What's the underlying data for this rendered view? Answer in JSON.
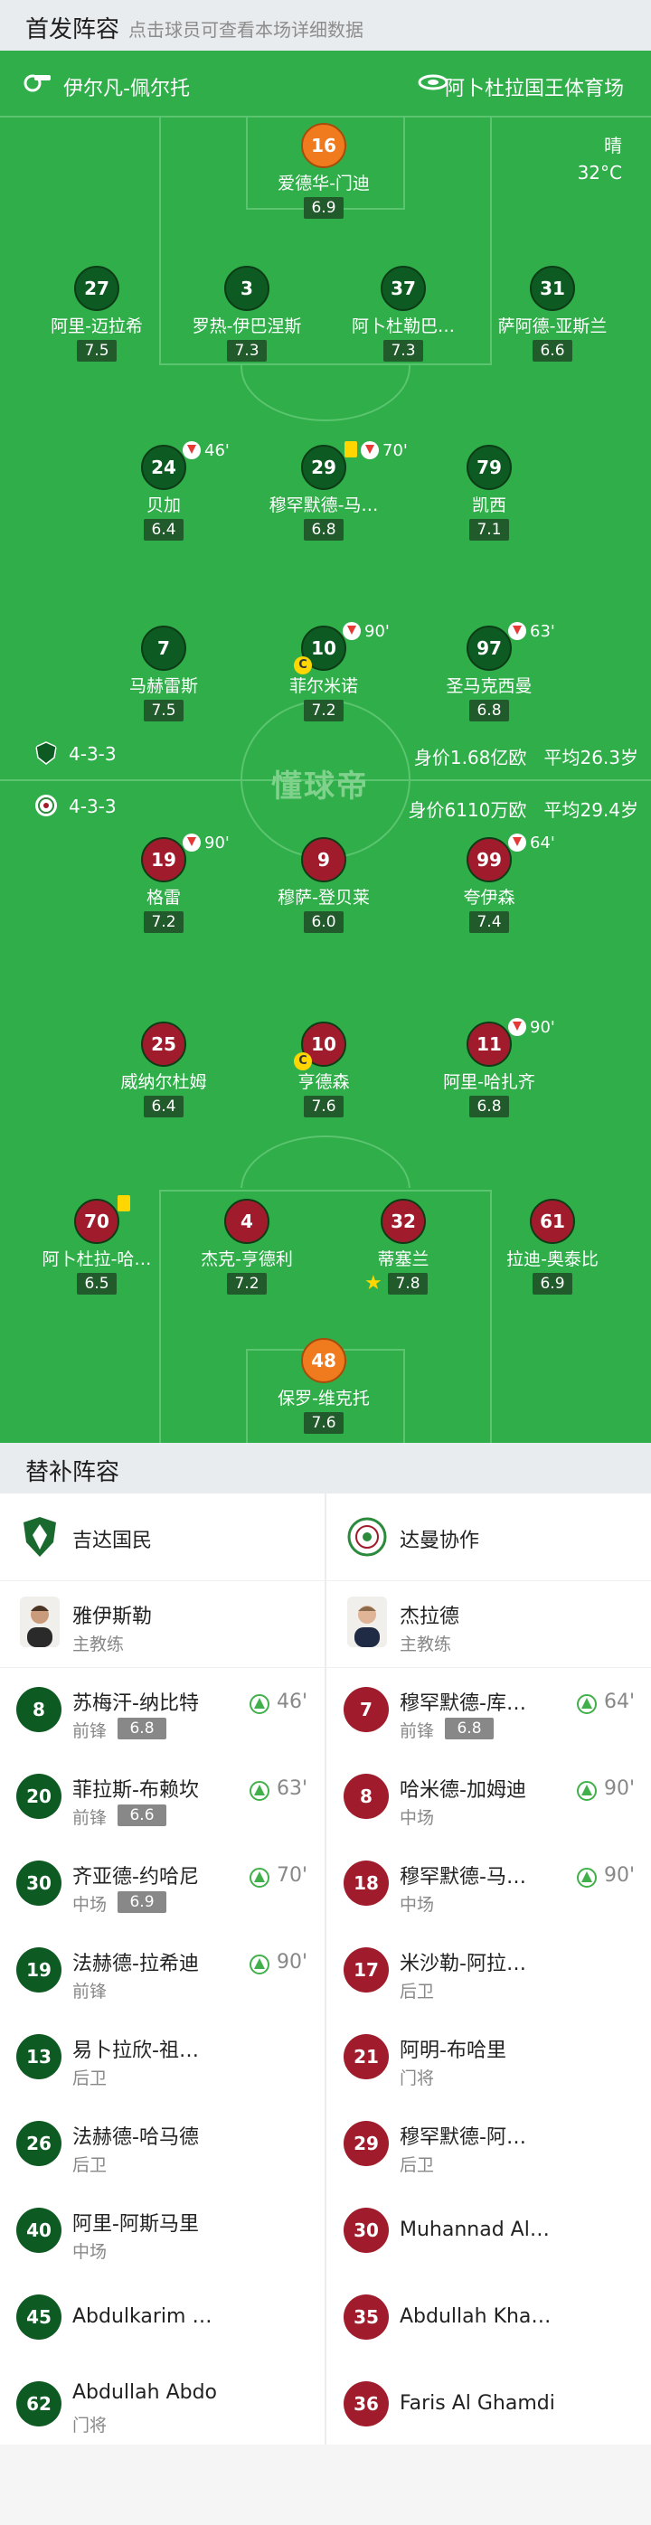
{
  "header": {
    "title": "首发阵容",
    "subtitle": "点击球员可查看本场详细数据"
  },
  "pitch": {
    "referee": "伊尔凡-佩尔托",
    "venue": "阿卜杜拉国王体育场",
    "weather": "晴",
    "temperature": "32°C",
    "watermark": "懂球帝"
  },
  "home_team": {
    "formation": "4-3-3",
    "value": "身价1.68亿欧",
    "avg_age": "平均26.3岁",
    "color": "#0d5a22"
  },
  "away_team": {
    "formation": "4-3-3",
    "value": "身价6110万欧",
    "avg_age": "平均29.4岁",
    "color": "#a01c2c"
  },
  "home_players": [
    {
      "num": "16",
      "name": "爱德华-门迪",
      "rating": "6.9"
    },
    {
      "num": "27",
      "name": "阿里-迈拉希",
      "rating": "7.5"
    },
    {
      "num": "3",
      "name": "罗热-伊巴涅斯",
      "rating": "7.3"
    },
    {
      "num": "37",
      "name": "阿卜杜勒巴…",
      "rating": "7.3"
    },
    {
      "num": "31",
      "name": "萨阿德-亚斯兰",
      "rating": "6.6"
    },
    {
      "num": "24",
      "name": "贝加",
      "rating": "6.4",
      "sub_min": "46'"
    },
    {
      "num": "29",
      "name": "穆罕默德-马…",
      "rating": "6.8",
      "sub_min": "70'"
    },
    {
      "num": "79",
      "name": "凯西",
      "rating": "7.1"
    },
    {
      "num": "7",
      "name": "马赫雷斯",
      "rating": "7.5"
    },
    {
      "num": "10",
      "name": "菲尔米诺",
      "rating": "7.2",
      "sub_min": "90'",
      "captain": "C"
    },
    {
      "num": "97",
      "name": "圣马克西曼",
      "rating": "6.8",
      "sub_min": "63'"
    }
  ],
  "away_players": [
    {
      "num": "19",
      "name": "格雷",
      "rating": "7.2",
      "sub_min": "90'"
    },
    {
      "num": "9",
      "name": "穆萨-登贝莱",
      "rating": "6.0"
    },
    {
      "num": "99",
      "name": "夸伊森",
      "rating": "7.4",
      "sub_min": "64'"
    },
    {
      "num": "25",
      "name": "威纳尔杜姆",
      "rating": "6.4"
    },
    {
      "num": "10",
      "name": "亨德森",
      "rating": "7.6",
      "captain": "C"
    },
    {
      "num": "11",
      "name": "阿里-哈扎齐",
      "rating": "6.8",
      "sub_min": "90'"
    },
    {
      "num": "70",
      "name": "阿卜杜拉-哈…",
      "rating": "6.5"
    },
    {
      "num": "4",
      "name": "杰克-亨德利",
      "rating": "7.2"
    },
    {
      "num": "32",
      "name": "蒂塞兰",
      "rating": "7.8"
    },
    {
      "num": "61",
      "name": "拉迪-奥泰比",
      "rating": "6.9"
    },
    {
      "num": "48",
      "name": "保罗-维克托",
      "rating": "7.6"
    }
  ],
  "subs_section": {
    "title": "替补阵容"
  },
  "subs": {
    "home_club": "吉达国民",
    "away_club": "达曼协作",
    "home_coach": {
      "name": "雅伊斯勒",
      "role": "主教练"
    },
    "away_coach": {
      "name": "杰拉德",
      "role": "主教练"
    },
    "home": [
      {
        "num": "8",
        "name": "苏梅汗-纳比特",
        "pos": "前锋",
        "rating": "6.8",
        "in": "46'"
      },
      {
        "num": "20",
        "name": "菲拉斯-布赖坎",
        "pos": "前锋",
        "rating": "6.6",
        "in": "63'"
      },
      {
        "num": "30",
        "name": "齐亚德-约哈尼",
        "pos": "中场",
        "rating": "6.9",
        "in": "70'"
      },
      {
        "num": "19",
        "name": "法赫德-拉希迪",
        "pos": "前锋",
        "in": "90'"
      },
      {
        "num": "13",
        "name": "易卜拉欣-祖…",
        "pos": "后卫"
      },
      {
        "num": "26",
        "name": "法赫德-哈马德",
        "pos": "后卫"
      },
      {
        "num": "40",
        "name": "阿里-阿斯马里",
        "pos": "中场"
      },
      {
        "num": "45",
        "name": "Abdulkarim …"
      },
      {
        "num": "62",
        "name": "Abdullah Abdo",
        "pos": "门将"
      }
    ],
    "away": [
      {
        "num": "7",
        "name": "穆罕默德-库…",
        "pos": "前锋",
        "rating": "6.8",
        "in": "64'"
      },
      {
        "num": "8",
        "name": "哈米德-加姆迪",
        "pos": "中场",
        "in": "90'"
      },
      {
        "num": "18",
        "name": "穆罕默德-马…",
        "pos": "中场",
        "in": "90'"
      },
      {
        "num": "17",
        "name": "米沙勒-阿拉…",
        "pos": "后卫"
      },
      {
        "num": "21",
        "name": "阿明-布哈里",
        "pos": "门将"
      },
      {
        "num": "29",
        "name": "穆罕默德-阿…",
        "pos": "后卫"
      },
      {
        "num": "30",
        "name": "Muhannad Al…"
      },
      {
        "num": "35",
        "name": "Abdullah Kha…"
      },
      {
        "num": "36",
        "name": "Faris Al Ghamdi"
      }
    ]
  }
}
